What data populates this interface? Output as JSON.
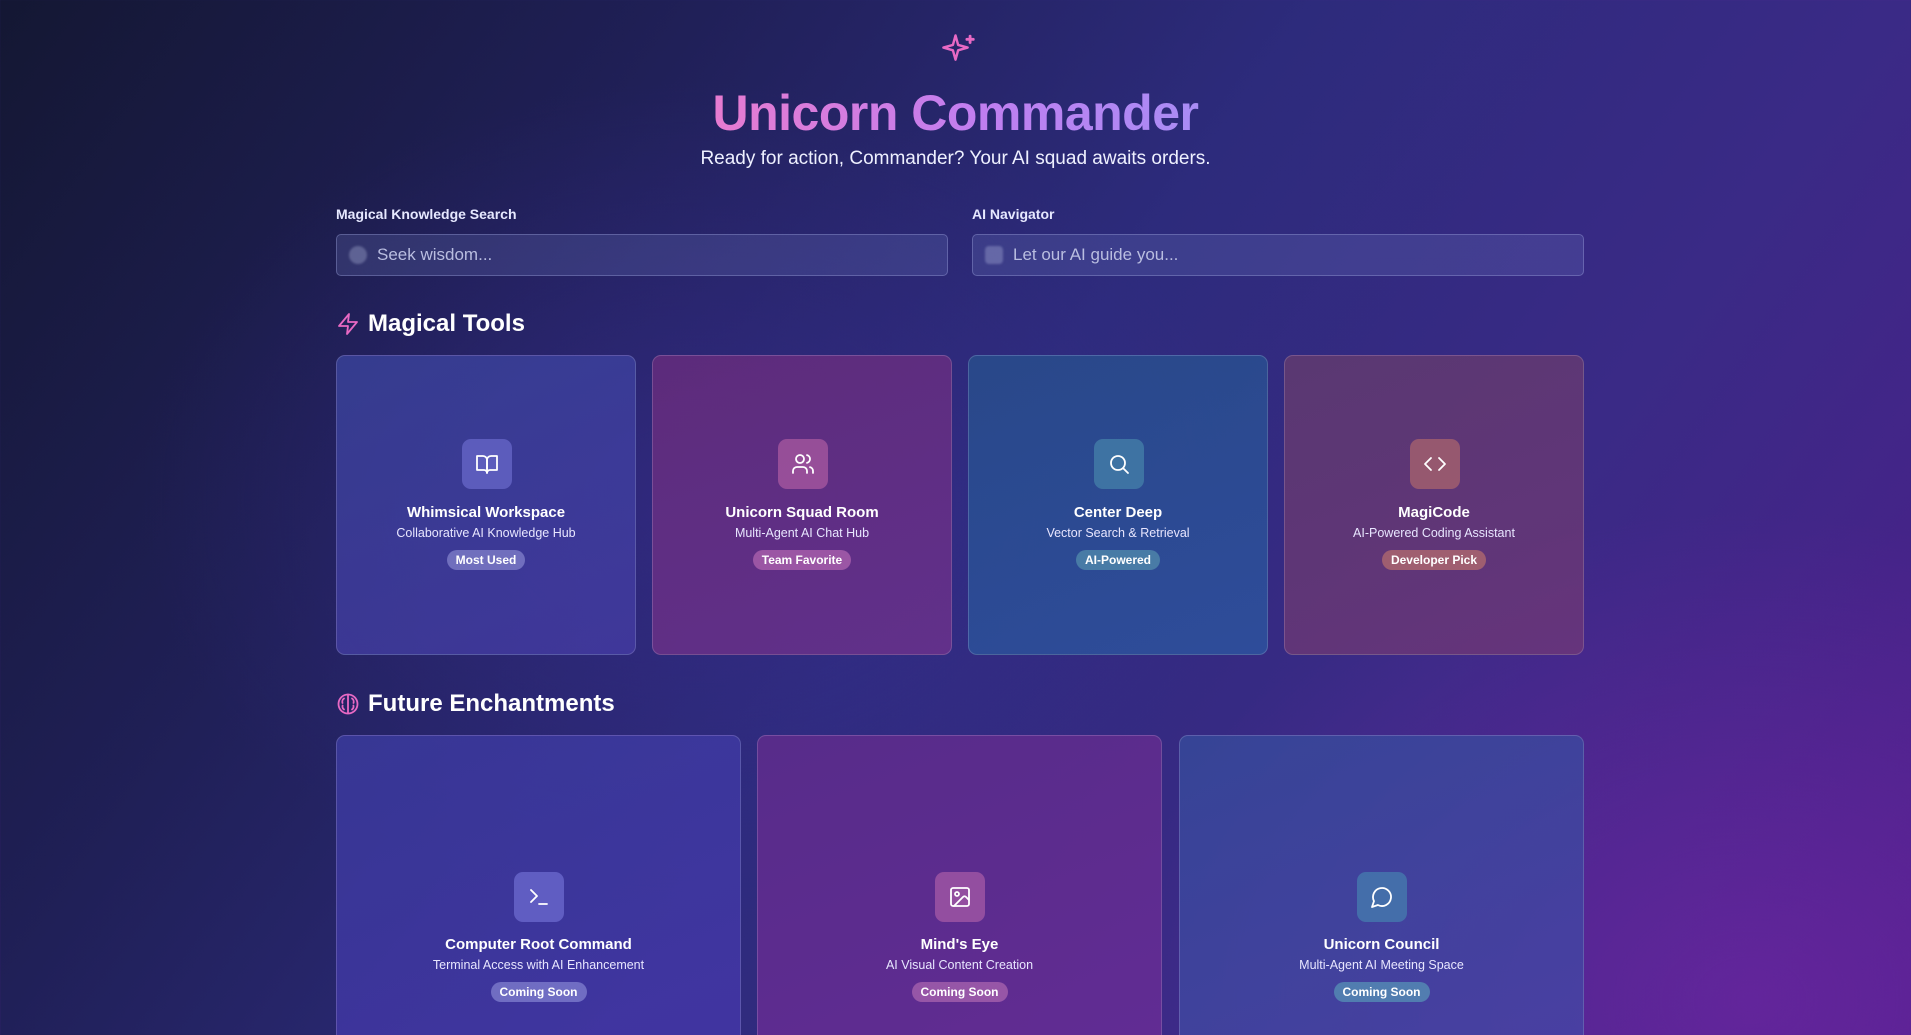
{
  "header": {
    "title": "Unicorn Commander",
    "subtitle": "Ready for action, Commander? Your AI squad awaits orders.",
    "logo_icon": "sparkles-icon"
  },
  "searches": {
    "knowledge": {
      "label": "Magical Knowledge Search",
      "placeholder": "Seek wisdom...",
      "value": ""
    },
    "navigator": {
      "label": "AI Navigator",
      "placeholder": "Let our AI guide you...",
      "value": ""
    }
  },
  "sections": {
    "tools": {
      "title": "Magical Tools",
      "icon": "lightning-icon",
      "cards": [
        {
          "name": "Whimsical Workspace",
          "description": "Collaborative AI Knowledge Hub",
          "badge": "Most Used",
          "icon": "book-icon"
        },
        {
          "name": "Unicorn Squad Room",
          "description": "Multi-Agent AI Chat Hub",
          "badge": "Team Favorite",
          "icon": "users-icon"
        },
        {
          "name": "Center Deep",
          "description": "Vector Search & Retrieval",
          "badge": "AI-Powered",
          "icon": "search-icon"
        },
        {
          "name": "MagiCode",
          "description": "AI-Powered Coding Assistant",
          "badge": "Developer Pick",
          "icon": "code-icon"
        }
      ]
    },
    "future": {
      "title": "Future Enchantments",
      "icon": "brain-icon",
      "cards": [
        {
          "name": "Computer Root Command",
          "description": "Terminal Access with AI Enhancement",
          "badge": "Coming Soon",
          "icon": "terminal-icon"
        },
        {
          "name": "Mind's Eye",
          "description": "AI Visual Content Creation",
          "badge": "Coming Soon",
          "icon": "image-icon"
        },
        {
          "name": "Unicorn Council",
          "description": "Multi-Agent AI Meeting Space",
          "badge": "Coming Soon",
          "icon": "message-circle-icon"
        }
      ]
    }
  },
  "colors": {
    "accent_pink": "#e869c4",
    "title_gradient_start": "#e77bd0",
    "title_gradient_end": "#a98cf5"
  }
}
